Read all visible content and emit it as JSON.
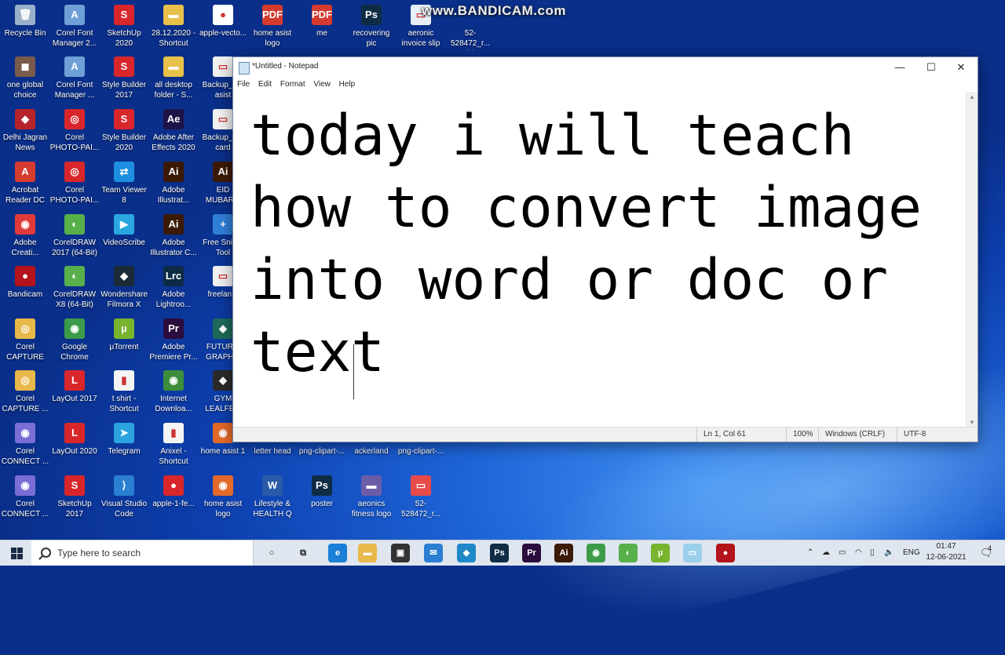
{
  "watermark": "www.BANDICAM.com",
  "desktop_icons": [
    {
      "label": "Recycle Bin",
      "glyph": "🗑",
      "color": "#9ab0c8"
    },
    {
      "label": "Corel Font\nManager 2...",
      "glyph": "A",
      "color": "#6e9fd6"
    },
    {
      "label": "SketchUp\n2020",
      "glyph": "S",
      "color": "#d9262b"
    },
    {
      "label": "28.12.2020 -\nShortcut",
      "glyph": "▬",
      "color": "#e8c14a"
    },
    {
      "label": "apple-vecto...",
      "glyph": "●",
      "color": "#ffffff"
    },
    {
      "label": "home asist\nlogo",
      "glyph": "PDF",
      "color": "#d63b2f"
    },
    {
      "label": "me",
      "glyph": "PDF",
      "color": "#d63b2f"
    },
    {
      "label": "recovering\npic",
      "glyph": "Ps",
      "color": "#0f2c45"
    },
    {
      "label": "aeronic\ninvoice slip",
      "glyph": "▭",
      "color": "#e8eef5"
    },
    {
      "label": "52-528472_r...\n(1)",
      "glyph": "",
      "color": "transparent"
    },
    {
      "label": "one global\nchoice",
      "glyph": "◼",
      "color": "#7a5b4b"
    },
    {
      "label": "Corel Font\nManager ...",
      "glyph": "A",
      "color": "#6e9fd6"
    },
    {
      "label": "Style Builder\n2017",
      "glyph": "S",
      "color": "#d9262b"
    },
    {
      "label": "all desktop\nfolder - S...",
      "glyph": "▬",
      "color": "#e8c14a"
    },
    {
      "label": "Backup_o...\nasist",
      "glyph": "▭",
      "color": "#f1f1f1"
    },
    {
      "label": "Delhi Jagran\nNews",
      "glyph": "◆",
      "color": "#b7232a"
    },
    {
      "label": "Corel\nPHOTO-PAI...",
      "glyph": "◎",
      "color": "#d9262b"
    },
    {
      "label": "Style Builder\n2020",
      "glyph": "S",
      "color": "#d9262b"
    },
    {
      "label": "Adobe After\nEffects 2020",
      "glyph": "Ae",
      "color": "#1d1347"
    },
    {
      "label": "Backup_o...\ncard",
      "glyph": "▭",
      "color": "#f1f1f1"
    },
    {
      "label": "Acrobat\nReader DC",
      "glyph": "A",
      "color": "#d63b2f"
    },
    {
      "label": "Corel\nPHOTO-PAI...",
      "glyph": "◎",
      "color": "#d9262b"
    },
    {
      "label": "Team Viewer\n8",
      "glyph": "⇄",
      "color": "#1e8fe0"
    },
    {
      "label": "Adobe\nIllustrat...",
      "glyph": "Ai",
      "color": "#3a1a05"
    },
    {
      "label": "EID\nMUBAR...",
      "glyph": "Ai",
      "color": "#3a1a05"
    },
    {
      "label": "Adobe\nCreati...",
      "glyph": "◉",
      "color": "#e03a3a"
    },
    {
      "label": "CorelDRAW\n2017 (64-Bit)",
      "glyph": "◐",
      "color": "#58b04a"
    },
    {
      "label": "VideoScribe",
      "glyph": "▶",
      "color": "#2aa6e0"
    },
    {
      "label": "Adobe\nIllustrator C...",
      "glyph": "Ai",
      "color": "#3a1a05"
    },
    {
      "label": "Free Snip...\nTool",
      "glyph": "+",
      "color": "#2f7fd6"
    },
    {
      "label": "Bandicam",
      "glyph": "●",
      "color": "#b3131b"
    },
    {
      "label": "CorelDRAW\nX8 (64-Bit)",
      "glyph": "◐",
      "color": "#58b04a"
    },
    {
      "label": "Wondershare\nFilmora X",
      "glyph": "◆",
      "color": "#1b2b35"
    },
    {
      "label": "Adobe\nLightroo...",
      "glyph": "Lrc",
      "color": "#0d2b44"
    },
    {
      "label": "freelan...",
      "glyph": "▭",
      "color": "#f1f1f1"
    },
    {
      "label": "Corel\nCAPTURE 2...",
      "glyph": "◎",
      "color": "#e8b84a"
    },
    {
      "label": "Google\nChrome",
      "glyph": "◉",
      "color": "#3c9b48"
    },
    {
      "label": "µTorrent",
      "glyph": "µ",
      "color": "#78b42d"
    },
    {
      "label": "Adobe\nPremiere Pr...",
      "glyph": "Pr",
      "color": "#2b0d3d"
    },
    {
      "label": "FUTUR...\nGRAPH...",
      "glyph": "◆",
      "color": "#1e6a5a"
    },
    {
      "label": "Corel\nCAPTURE ...",
      "glyph": "◎",
      "color": "#e8b84a"
    },
    {
      "label": "LayOut 2017",
      "glyph": "L",
      "color": "#d9262b"
    },
    {
      "label": "t shirt -\nShortcut",
      "glyph": "▮",
      "color": "#f4f4f4"
    },
    {
      "label": "Internet\nDownloa...",
      "glyph": "◉",
      "color": "#3c8e3c"
    },
    {
      "label": "GYM\nLEALFE...",
      "glyph": "◆",
      "color": "#2a2a2a"
    },
    {
      "label": "Corel\nCONNECT ...",
      "glyph": "◉",
      "color": "#7a6ed6"
    },
    {
      "label": "LayOut 2020",
      "glyph": "L",
      "color": "#d9262b"
    },
    {
      "label": "Telegram",
      "glyph": "➤",
      "color": "#2aa3df"
    },
    {
      "label": "Anixel -\nShortcut",
      "glyph": "▮",
      "color": "#f4f4f4"
    },
    {
      "label": "home asist 1",
      "glyph": "◉",
      "color": "#e36a2b"
    },
    {
      "label": "letter head",
      "glyph": "",
      "color": "transparent"
    },
    {
      "label": "png-clipart-...",
      "glyph": "",
      "color": "transparent"
    },
    {
      "label": "ackerland",
      "glyph": "",
      "color": "transparent"
    },
    {
      "label": "png-clipart-...",
      "glyph": "",
      "color": "transparent"
    },
    {
      "label": "Corel\nCONNECT ...",
      "glyph": "◉",
      "color": "#7a6ed6"
    },
    {
      "label": "SketchUp\n2017",
      "glyph": "S",
      "color": "#d9262b"
    },
    {
      "label": "Visual Studio\nCode",
      "glyph": "⟩",
      "color": "#2a7fd0"
    },
    {
      "label": "apple-1-fe...",
      "glyph": "●",
      "color": "#d9262b"
    },
    {
      "label": "home asist\nlogo",
      "glyph": "◉",
      "color": "#e36a2b"
    },
    {
      "label": "Lifestyle &\nHEALTH Q",
      "glyph": "W",
      "color": "#2a5aa8"
    },
    {
      "label": "poster",
      "glyph": "Ps",
      "color": "#0f2c45"
    },
    {
      "label": "aeonics\nfitness logo",
      "glyph": "▬",
      "color": "#6d5ca8"
    },
    {
      "label": "52-528472_r...",
      "glyph": "▭",
      "color": "#e84a4a"
    }
  ],
  "notepad": {
    "title": "*Untitled - Notepad",
    "menu": [
      "File",
      "Edit",
      "Format",
      "View",
      "Help"
    ],
    "content": "today i will teach how to convert image into word or doc or text",
    "status": {
      "position": "Ln 1, Col 61",
      "zoom": "100%",
      "line_ending": "Windows (CRLF)",
      "encoding": "UTF-8"
    }
  },
  "taskbar": {
    "search_placeholder": "Type here to search",
    "pinned": [
      {
        "name": "cortana",
        "glyph": "○",
        "color": "transparent"
      },
      {
        "name": "task-view",
        "glyph": "⧉",
        "color": "transparent"
      },
      {
        "name": "edge",
        "glyph": "e",
        "color": "#1a7fd6"
      },
      {
        "name": "file-explorer",
        "glyph": "▬",
        "color": "#e8b84a"
      },
      {
        "name": "store",
        "glyph": "▣",
        "color": "#333333"
      },
      {
        "name": "mail",
        "glyph": "✉",
        "color": "#2a7fd0"
      },
      {
        "name": "bird-app",
        "glyph": "◆",
        "color": "#1e88c8"
      },
      {
        "name": "photoshop",
        "glyph": "Ps",
        "color": "#0f2c45"
      },
      {
        "name": "premiere",
        "glyph": "Pr",
        "color": "#2b0d3d"
      },
      {
        "name": "illustrator",
        "glyph": "Ai",
        "color": "#3a1a05"
      },
      {
        "name": "chrome",
        "glyph": "◉",
        "color": "#3c9b48"
      },
      {
        "name": "coreldraw",
        "glyph": "◐",
        "color": "#58b04a"
      },
      {
        "name": "utorrent",
        "glyph": "µ",
        "color": "#78b42d"
      },
      {
        "name": "notepad",
        "glyph": "▭",
        "color": "#9ad0ea"
      },
      {
        "name": "bandicam",
        "glyph": "●",
        "color": "#b3131b"
      }
    ],
    "tray_language": "ENG",
    "time": "01:47",
    "date": "12-06-2021",
    "notification_count": "4"
  }
}
